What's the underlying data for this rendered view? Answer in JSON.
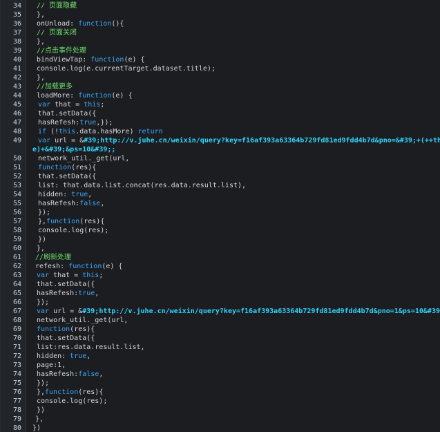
{
  "editor": {
    "lines": [
      {
        "number": "34",
        "indent": 1,
        "tokens": [
          {
            "t": "// 页面隐藏",
            "c": "comment"
          }
        ]
      },
      {
        "number": "35",
        "indent": 1,
        "tokens": [
          {
            "t": "},",
            "c": "plain"
          }
        ]
      },
      {
        "number": "36",
        "indent": 1,
        "tokens": [
          {
            "t": "onUnload: ",
            "c": "plain"
          },
          {
            "t": "function",
            "c": "kw"
          },
          {
            "t": "(){",
            "c": "plain"
          }
        ]
      },
      {
        "number": "37",
        "indent": 1,
        "tokens": [
          {
            "t": "// 页面关闭",
            "c": "comment"
          }
        ]
      },
      {
        "number": "38",
        "indent": 1,
        "tokens": [
          {
            "t": "},",
            "c": "plain"
          }
        ]
      },
      {
        "number": "39",
        "indent": 1,
        "tokens": [
          {
            "t": "//点击事件处理",
            "c": "comment"
          }
        ]
      },
      {
        "number": "40",
        "indent": 1,
        "tokens": [
          {
            "t": "bindViewTap: ",
            "c": "plain"
          },
          {
            "t": "function",
            "c": "kw"
          },
          {
            "t": "(e) {",
            "c": "plain"
          }
        ]
      },
      {
        "number": "41",
        "indent": 1,
        "tokens": [
          {
            "t": "console.log(e.currentTarget.dataset.title);",
            "c": "plain"
          }
        ]
      },
      {
        "number": "42",
        "indent": 1,
        "tokens": [
          {
            "t": "},",
            "c": "plain"
          }
        ]
      },
      {
        "number": "43",
        "indent": 1,
        "tokens": [
          {
            "t": "//加载更多",
            "c": "comment"
          }
        ]
      },
      {
        "number": "44",
        "indent": 1,
        "tokens": [
          {
            "t": "loadMore: ",
            "c": "plain"
          },
          {
            "t": "function",
            "c": "kw"
          },
          {
            "t": "(e) {",
            "c": "plain"
          }
        ]
      },
      {
        "number": "45",
        "indent": 2,
        "tokens": [
          {
            "t": "var",
            "c": "kw"
          },
          {
            "t": " that = ",
            "c": "plain"
          },
          {
            "t": "this",
            "c": "kw"
          },
          {
            "t": ";",
            "c": "plain"
          }
        ]
      },
      {
        "number": "46",
        "indent": 2,
        "tokens": [
          {
            "t": "that.setData({",
            "c": "plain"
          }
        ]
      },
      {
        "number": "47",
        "indent": 2,
        "tokens": [
          {
            "t": "hasRefesh:",
            "c": "plain"
          },
          {
            "t": "true",
            "c": "kw"
          },
          {
            "t": ",});",
            "c": "plain"
          }
        ]
      },
      {
        "number": "48",
        "indent": 2,
        "tokens": [
          {
            "t": "if",
            "c": "kw"
          },
          {
            "t": " (!",
            "c": "plain"
          },
          {
            "t": "this",
            "c": "kw"
          },
          {
            "t": ".data.hasMore) ",
            "c": "plain"
          },
          {
            "t": "return",
            "c": "kw"
          }
        ]
      },
      {
        "number": "49",
        "indent": 2,
        "tokens": [
          {
            "t": "var",
            "c": "kw"
          },
          {
            "t": " url = &",
            "c": "plain"
          },
          {
            "t": "#39;http://v.juhe.cn/weixin/query?key=f16af393a63364b729fd81ed9fdd4b7d&pno=&#39;+(++that.data.pag",
            "c": "str"
          }
        ]
      },
      {
        "number": "",
        "indent": -1,
        "tokens": [
          {
            "t": "e)+&#39;&ps=10&#39;;",
            "c": "str"
          }
        ]
      },
      {
        "number": "50",
        "indent": 2,
        "tokens": [
          {
            "t": "network_util._get(url,",
            "c": "plain"
          }
        ]
      },
      {
        "number": "51",
        "indent": 2,
        "tokens": [
          {
            "t": "function",
            "c": "kw"
          },
          {
            "t": "(res){",
            "c": "plain"
          }
        ]
      },
      {
        "number": "52",
        "indent": 2,
        "tokens": [
          {
            "t": "that.setData({",
            "c": "plain"
          }
        ]
      },
      {
        "number": "53",
        "indent": 2,
        "tokens": [
          {
            "t": "list: that.data.list.concat(res.data.result.list),",
            "c": "plain"
          }
        ]
      },
      {
        "number": "54",
        "indent": 2,
        "tokens": [
          {
            "t": "hidden: ",
            "c": "plain"
          },
          {
            "t": "true",
            "c": "kw"
          },
          {
            "t": ",",
            "c": "plain"
          }
        ]
      },
      {
        "number": "55",
        "indent": 2,
        "tokens": [
          {
            "t": "hasRefesh:",
            "c": "plain"
          },
          {
            "t": "false",
            "c": "kw"
          },
          {
            "t": ",",
            "c": "plain"
          }
        ]
      },
      {
        "number": "56",
        "indent": 2,
        "tokens": [
          {
            "t": "});",
            "c": "plain"
          }
        ]
      },
      {
        "number": "57",
        "indent": 2,
        "tokens": [
          {
            "t": "},",
            "c": "plain"
          },
          {
            "t": "function",
            "c": "kw"
          },
          {
            "t": "(res){",
            "c": "plain"
          }
        ]
      },
      {
        "number": "58",
        "indent": 2,
        "tokens": [
          {
            "t": "console.log(res);",
            "c": "plain"
          }
        ]
      },
      {
        "number": "59",
        "indent": 2,
        "tokens": [
          {
            "t": "})",
            "c": "plain"
          }
        ]
      },
      {
        "number": "60",
        "indent": 1,
        "tokens": [
          {
            "t": "},",
            "c": "plain"
          }
        ]
      },
      {
        "number": "61",
        "indent": 0,
        "tokens": [
          {
            "t": "//刷新处理",
            "c": "comment"
          }
        ]
      },
      {
        "number": "62",
        "indent": 0,
        "tokens": [
          {
            "t": "refesh: ",
            "c": "plain"
          },
          {
            "t": "function",
            "c": "kw"
          },
          {
            "t": "(e) {",
            "c": "plain"
          }
        ]
      },
      {
        "number": "63",
        "indent": 1,
        "tokens": [
          {
            "t": "var",
            "c": "kw"
          },
          {
            "t": " that = ",
            "c": "plain"
          },
          {
            "t": "this",
            "c": "kw"
          },
          {
            "t": ";",
            "c": "plain"
          }
        ]
      },
      {
        "number": "64",
        "indent": 1,
        "tokens": [
          {
            "t": "that.setData({",
            "c": "plain"
          }
        ]
      },
      {
        "number": "65",
        "indent": 1,
        "tokens": [
          {
            "t": "hasRefesh:",
            "c": "plain"
          },
          {
            "t": "true",
            "c": "kw"
          },
          {
            "t": ",",
            "c": "plain"
          }
        ]
      },
      {
        "number": "66",
        "indent": 1,
        "tokens": [
          {
            "t": "});",
            "c": "plain"
          }
        ]
      },
      {
        "number": "67",
        "indent": 1,
        "tokens": [
          {
            "t": "var",
            "c": "kw"
          },
          {
            "t": " url = &",
            "c": "plain"
          },
          {
            "t": "#39;http://v.juhe.cn/weixin/query?key=f16af393a63364b729fd81ed9fdd4b7d&pno=1&ps=10&#39;;",
            "c": "str"
          }
        ]
      },
      {
        "number": "68",
        "indent": 1,
        "tokens": [
          {
            "t": "network_util._get(url,",
            "c": "plain"
          }
        ]
      },
      {
        "number": "69",
        "indent": 1,
        "tokens": [
          {
            "t": "function",
            "c": "kw"
          },
          {
            "t": "(res){",
            "c": "plain"
          }
        ]
      },
      {
        "number": "70",
        "indent": 1,
        "tokens": [
          {
            "t": "that.setData({",
            "c": "plain"
          }
        ]
      },
      {
        "number": "71",
        "indent": 1,
        "tokens": [
          {
            "t": "list:res.data.result.list,",
            "c": "plain"
          }
        ]
      },
      {
        "number": "72",
        "indent": 1,
        "tokens": [
          {
            "t": "hidden: ",
            "c": "plain"
          },
          {
            "t": "true",
            "c": "kw"
          },
          {
            "t": ",",
            "c": "plain"
          }
        ]
      },
      {
        "number": "73",
        "indent": 1,
        "tokens": [
          {
            "t": "page:1,",
            "c": "plain"
          }
        ]
      },
      {
        "number": "74",
        "indent": 1,
        "tokens": [
          {
            "t": "hasRefesh:",
            "c": "plain"
          },
          {
            "t": "false",
            "c": "kw"
          },
          {
            "t": ",",
            "c": "plain"
          }
        ]
      },
      {
        "number": "75",
        "indent": 1,
        "tokens": [
          {
            "t": "});",
            "c": "plain"
          }
        ]
      },
      {
        "number": "76",
        "indent": 1,
        "tokens": [
          {
            "t": "},",
            "c": "plain"
          },
          {
            "t": "function",
            "c": "kw"
          },
          {
            "t": "(res){",
            "c": "plain"
          }
        ]
      },
      {
        "number": "77",
        "indent": 1,
        "tokens": [
          {
            "t": "console.log(res);",
            "c": "plain"
          }
        ]
      },
      {
        "number": "78",
        "indent": 1,
        "tokens": [
          {
            "t": "})",
            "c": "plain"
          }
        ]
      },
      {
        "number": "79",
        "indent": 0,
        "tokens": [
          {
            "t": "},",
            "c": "plain"
          }
        ]
      },
      {
        "number": "80",
        "indent": -1,
        "tokens": [
          {
            "t": "})",
            "c": "plain"
          }
        ]
      }
    ]
  },
  "colors": {
    "background": "#1c1d20",
    "gutter": "#22262b",
    "comment": "#6ee06e",
    "keyword": "#39a9ff",
    "string": "#2fd6ff",
    "text": "#d6d8dc"
  }
}
